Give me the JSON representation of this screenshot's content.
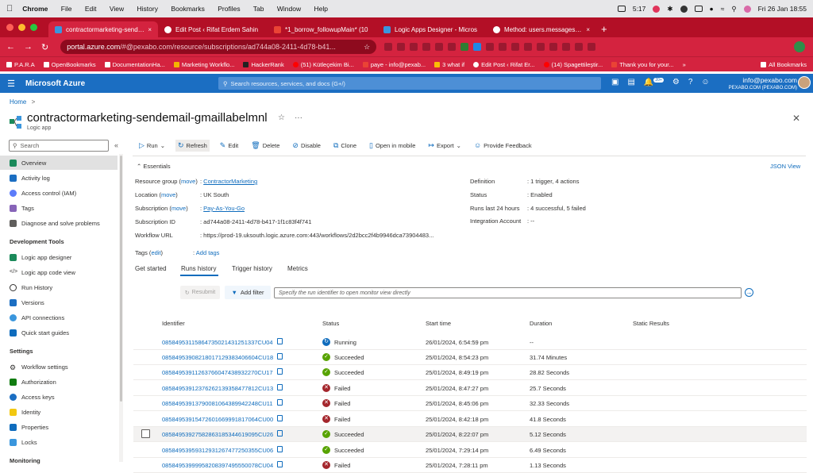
{
  "macbar": {
    "app": "Chrome",
    "menus": [
      "File",
      "Edit",
      "View",
      "History",
      "Bookmarks",
      "Profiles",
      "Tab",
      "Window",
      "Help"
    ],
    "time": "5:17",
    "clock": "Fri 26 Jan  18:55"
  },
  "tabs": [
    {
      "title": "contractormarketing-sendem",
      "icon": "azure-icon",
      "active": true
    },
    {
      "title": "Edit Post ‹ Rifat Erdem Sahin",
      "icon": "wordpress-icon",
      "active": false
    },
    {
      "title": "*1_borrow_followupMain* (10",
      "icon": "gmail-icon",
      "active": false
    },
    {
      "title": "Logic Apps Designer - Micros",
      "icon": "azure-icon",
      "active": false
    },
    {
      "title": "Method: users.messages.list",
      "icon": "google-icon",
      "active": false
    }
  ],
  "address": {
    "host": "portal.azure.com",
    "rest": "/#@pexabo.com/resource/subscriptions/ad744a08-2411-4d78-b41..."
  },
  "bookmarks": [
    "P.A.R.A",
    "OpenBookmarks",
    "DocumentationHa...",
    "Marketing Workflo...",
    "HackerRank",
    "(51) Kütleçekim Bi...",
    "paye - info@pexab...",
    "3 what if",
    "Edit Post ‹ Rifat Er...",
    "(14) Spagettileştir...",
    "Thank you for your..."
  ],
  "bookmarks_all": "All Bookmarks",
  "azure": {
    "brand": "Microsoft Azure",
    "search_placeholder": "Search resources, services, and docs (G+/)",
    "notif_count": "20+",
    "user_email": "info@pexabo.com",
    "user_tenant": "PEXABO.COM (PEXABO.COM)"
  },
  "breadcrumb": {
    "home": "Home",
    "sep": ">"
  },
  "resource": {
    "title": "contractormarketing-sendemail-gmaillabelmnl",
    "subtitle": "Logic app"
  },
  "sidebar": {
    "search": "Search",
    "items_top": [
      "Overview",
      "Activity log",
      "Access control (IAM)",
      "Tags",
      "Diagnose and solve problems"
    ],
    "section_dev": "Development Tools",
    "items_dev": [
      "Logic app designer",
      "Logic app code view",
      "Run History",
      "Versions",
      "API connections",
      "Quick start guides"
    ],
    "section_settings": "Settings",
    "items_settings": [
      "Workflow settings",
      "Authorization",
      "Access keys",
      "Identity",
      "Properties",
      "Locks"
    ],
    "section_monitoring": "Monitoring"
  },
  "commands": [
    "Run",
    "Refresh",
    "Edit",
    "Delete",
    "Disable",
    "Clone",
    "Open in mobile",
    "Export",
    "Provide Feedback"
  ],
  "essentials": {
    "label": "Essentials",
    "json_view": "JSON View",
    "resource_group_label": "Resource group",
    "move": "move",
    "resource_group": "ContractorMarketing",
    "location_label": "Location",
    "location": "UK South",
    "subscription_label": "Subscription",
    "subscription": "Pay-As-You-Go",
    "subscription_id_label": "Subscription ID",
    "subscription_id": "ad744a08-2411-4d78-b417-1f1c83f4f741",
    "workflow_url_label": "Workflow URL",
    "workflow_url": "https://prod-19.uksouth.logic.azure.com:443/workflows/2d2bcc2f4b9946dca73904483...",
    "definition_label": "Definition",
    "definition": "1 trigger, 4 actions",
    "status_label": "Status",
    "status": "Enabled",
    "runs_label": "Runs last 24 hours",
    "runs": "4 successful, 5 failed",
    "integration_label": "Integration Account",
    "integration": "--",
    "tags_label": "Tags",
    "edit": "edit",
    "add_tags": "Add tags"
  },
  "page_tabs": [
    "Get started",
    "Runs history",
    "Trigger history",
    "Metrics"
  ],
  "filter": {
    "resubmit": "Resubmit",
    "add_filter": "Add filter",
    "placeholder": "Specify the run identifier to open monitor view directly"
  },
  "table": {
    "headers": [
      "Identifier",
      "Status",
      "Start time",
      "Duration",
      "Static Results"
    ],
    "rows": [
      {
        "id": "08584953115864735021431251337CU04",
        "status": "Running",
        "start": "26/01/2024, 6:54:59 pm",
        "duration": "--"
      },
      {
        "id": "08584953908218017129383406604CU18",
        "status": "Succeeded",
        "start": "25/01/2024, 8:54:23 pm",
        "duration": "31.74 Minutes"
      },
      {
        "id": "08584953911263766047438932270CU17",
        "status": "Succeeded",
        "start": "25/01/2024, 8:49:19 pm",
        "duration": "28.82 Seconds"
      },
      {
        "id": "08584953912376262139358477812CU13",
        "status": "Failed",
        "start": "25/01/2024, 8:47:27 pm",
        "duration": "25.7 Seconds"
      },
      {
        "id": "08584953913790081064389942248CU11",
        "status": "Failed",
        "start": "25/01/2024, 8:45:06 pm",
        "duration": "32.33 Seconds"
      },
      {
        "id": "08584953915472601669991817064CU00",
        "status": "Failed",
        "start": "25/01/2024, 8:42:18 pm",
        "duration": "41.8 Seconds"
      },
      {
        "id": "08584953927582863185344619095CU26",
        "status": "Succeeded",
        "start": "25/01/2024, 8:22:07 pm",
        "duration": "5.12 Seconds"
      },
      {
        "id": "08584953959312931267477250355CU06",
        "status": "Succeeded",
        "start": "25/01/2024, 7:29:14 pm",
        "duration": "6.49 Seconds"
      },
      {
        "id": "08584953999958208397495550078CU04",
        "status": "Failed",
        "start": "25/01/2024, 7:28:11 pm",
        "duration": "1.13 Seconds"
      }
    ]
  },
  "colors": {
    "chrome": "#d4233f",
    "azure": "#1b6ec2",
    "running": "#0f6cbd",
    "succeeded": "#57a300",
    "failed": "#a4262c",
    "link": "#0f6cbd"
  }
}
